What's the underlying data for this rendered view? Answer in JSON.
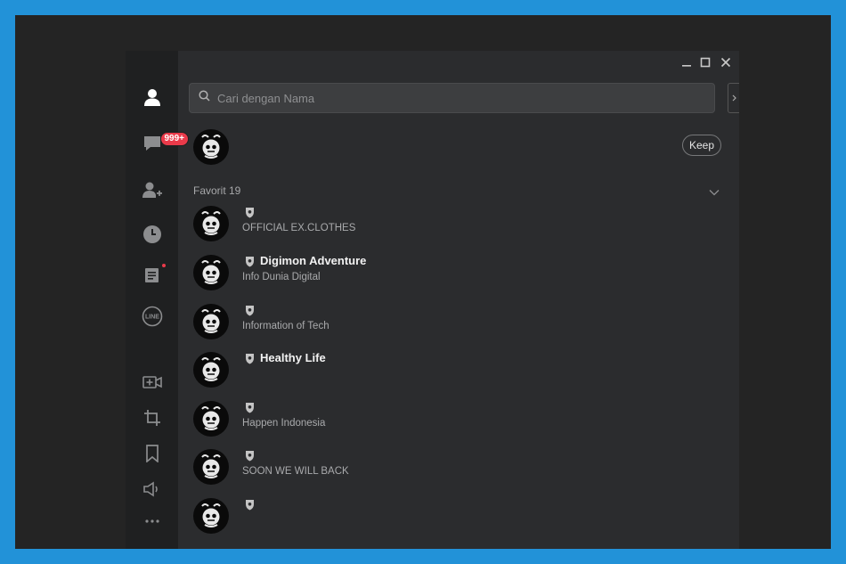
{
  "sidebar": {
    "items": [
      {
        "name": "profile-icon"
      },
      {
        "name": "chat-icon",
        "badge": "999+"
      },
      {
        "name": "add-friend-icon"
      },
      {
        "name": "clock-icon"
      },
      {
        "name": "notes-icon"
      },
      {
        "name": "line-icon",
        "label": "LINE"
      },
      {
        "name": "video-add-icon"
      },
      {
        "name": "crop-icon"
      },
      {
        "name": "bookmark-icon"
      },
      {
        "name": "speaker-icon"
      },
      {
        "name": "more-icon",
        "label": "···"
      }
    ]
  },
  "search": {
    "placeholder": "Cari dengan Nama"
  },
  "keep": {
    "label": "Keep"
  },
  "favorites": {
    "label": "Favorit 19",
    "items": [
      {
        "name": "",
        "status": "OFFICIAL EX.CLOTHES"
      },
      {
        "name": "Digimon Adventure",
        "status": "Info Dunia Digital"
      },
      {
        "name": "",
        "status": "Information of Tech"
      },
      {
        "name": "Healthy Life",
        "status": ""
      },
      {
        "name": "",
        "status": "Happen Indonesia"
      },
      {
        "name": "",
        "status": "SOON WE WILL BACK"
      },
      {
        "name": "",
        "status": ""
      }
    ]
  },
  "colors": {
    "background": "#2292d8",
    "app_bg": "#2b2c2e",
    "sidebar_bg": "#1f2021",
    "badge": "#ea3a4a"
  }
}
